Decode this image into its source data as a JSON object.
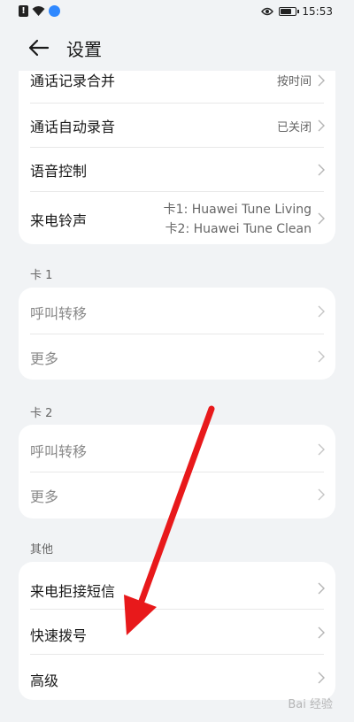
{
  "status_bar": {
    "alert_badge": "!",
    "time": "15:53",
    "icons": [
      "alert-icon",
      "wifi-icon",
      "app-notification-icon",
      "eye-icon",
      "battery-icon"
    ]
  },
  "header": {
    "back_icon": "back-arrow-icon",
    "title": "设置"
  },
  "group_top": {
    "items": [
      {
        "label": "通话记录合并",
        "value": "按时间"
      },
      {
        "label": "通话自动录音",
        "value": "已关闭"
      },
      {
        "label": "语音控制"
      },
      {
        "label": "来电铃声",
        "value_line1": "卡1: Huawei Tune Living",
        "value_line2": "卡2: Huawei Tune Clean"
      }
    ]
  },
  "card1": {
    "section_title": "卡 1",
    "items": [
      {
        "label": "呼叫转移"
      },
      {
        "label": "更多"
      }
    ]
  },
  "card2": {
    "section_title": "卡 2",
    "items": [
      {
        "label": "呼叫转移"
      },
      {
        "label": "更多"
      }
    ]
  },
  "other": {
    "section_title": "其他",
    "items": [
      {
        "label": "来电拒接短信"
      },
      {
        "label": "快速拨号"
      },
      {
        "label": "高级"
      }
    ]
  },
  "overlay": {
    "annotation_color": "#e8191b"
  },
  "watermark": "Bai 经验"
}
